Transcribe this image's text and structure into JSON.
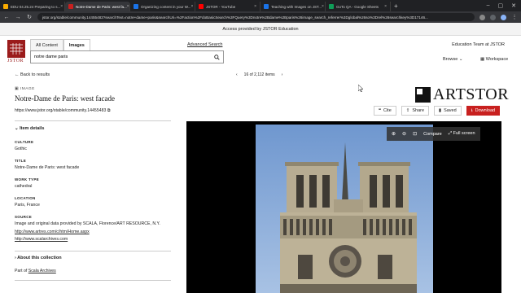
{
  "browser": {
    "tabs": [
      {
        "label": "EDU 04.25.24 Preparing to s...",
        "color": "#f9ab00",
        "active": false
      },
      {
        "label": "Notre-Dame de Paris: west fa...",
        "color": "#c8201f",
        "active": true
      },
      {
        "label": "Organizing content in your W...",
        "color": "#1a73e8",
        "active": false
      },
      {
        "label": "JSTOR - YouTube",
        "color": "#ff0000",
        "active": false
      },
      {
        "label": "Teaching with Images on JST...",
        "color": "#1a73e8",
        "active": false
      },
      {
        "label": "GoTo QA - Google Sheets",
        "color": "#0f9d58",
        "active": false
      }
    ],
    "url": "jstor.org/stable/community.14455483?searchText=notre+dame+paris&searchUri=%2Faction%2FdoBasicSearch%3FQuery%3Dnotre%2Bdame%2Bparis%26image_search_referrer%3Dglobal%26so%3Drel%26searchkey%3D17146..."
  },
  "banner": "Access provided by JSTOR Education",
  "logo": {
    "word": "JSTOR"
  },
  "search": {
    "tabs": [
      "All Content",
      "Images"
    ],
    "value": "notre dame paris",
    "advanced": "Advanced Search"
  },
  "header": {
    "team": "Education Team at JSTOR",
    "browse": "Browse",
    "workspace": "Workspace"
  },
  "nav": {
    "back": "Back to results",
    "pager": "16 of 2,112 items"
  },
  "item": {
    "type": "IMAGE",
    "title": "Notre-Dame de Paris: west facade",
    "stable_url": "https://www.jstor.org/stable/community.14455483"
  },
  "actions": {
    "cite": "Cite",
    "share": "Share",
    "saved": "Saved",
    "download": "Download"
  },
  "artstor": {
    "word": "ARTSTOR"
  },
  "details": {
    "heading": "Item details",
    "culture_label": "CULTURE",
    "culture": "Gothic",
    "title_label": "TITLE",
    "title": "Notre-Dame de Paris: west facade",
    "worktype_label": "WORK TYPE",
    "worktype": "cathedral",
    "location_label": "LOCATION",
    "location": "Paris, France",
    "source_label": "SOURCE",
    "source": "Image and original data provided by SCALA, Florence/ART RESOURCE, N.Y.",
    "link1": "http://www.artres.com/c/htm/Home.aspx",
    "link2": "http://www.scalarchives.com"
  },
  "collection": {
    "heading": "About this collection",
    "part_of": "Part of",
    "name": "Scala Archives"
  },
  "viewer": {
    "compare": "Compare",
    "fullscreen": "Full screen"
  },
  "colors": {
    "accent": "#c8201f",
    "logo": "#9b1b1b"
  }
}
